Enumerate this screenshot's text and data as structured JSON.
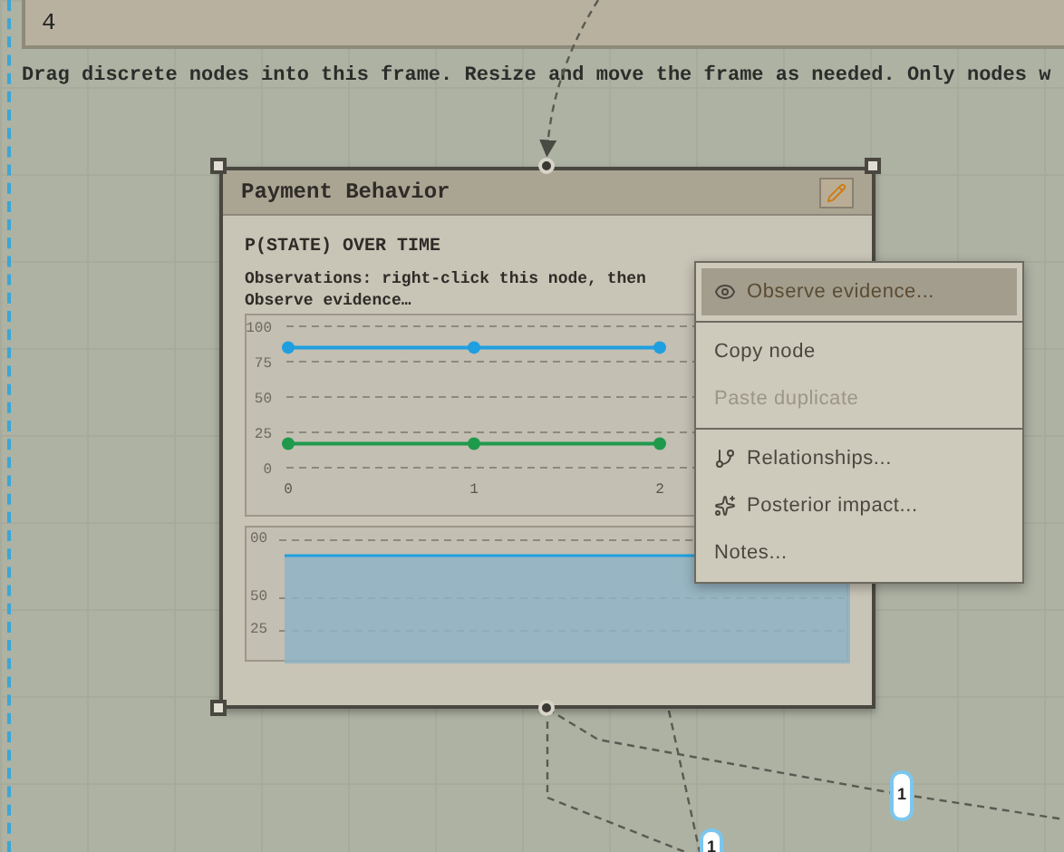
{
  "top_field": {
    "value": "4"
  },
  "hint": "Drag discrete nodes into this frame. Resize and move the frame as needed. Only nodes w",
  "node": {
    "title": "Payment Behavior",
    "section_title": "P(STATE) OVER TIME",
    "note_lines": [
      "Observations: right-click this node, then",
      "Observe evidence…"
    ],
    "chart_data": {
      "type": "line",
      "x": [
        0,
        1,
        2
      ],
      "xlim": [
        0,
        3
      ],
      "xticks": [
        0,
        1,
        2
      ],
      "ylim": [
        0,
        100
      ],
      "yticks": [
        {
          "value": 0,
          "label": "0"
        },
        {
          "value": 25,
          "label": "25"
        },
        {
          "value": 50,
          "label": "50"
        },
        {
          "value": 75,
          "label": "75"
        },
        {
          "value": 100,
          "label": "100"
        }
      ],
      "grid": true,
      "series": [
        {
          "color": "#1f9fe0",
          "marker": "circle",
          "values": [
            85,
            85,
            85
          ]
        },
        {
          "color": "#1f9a4c",
          "marker": "circle",
          "values": [
            17,
            17,
            17
          ]
        }
      ]
    },
    "area_chart": {
      "kind": "area",
      "tick_labels": [
        "00",
        "50",
        "25"
      ]
    }
  },
  "menu": [
    {
      "kind": "item",
      "label": "Observe evidence...",
      "selected": true,
      "disabled": false
    },
    {
      "kind": "separator"
    },
    {
      "kind": "item",
      "label": "Copy node",
      "selected": false,
      "disabled": false
    },
    {
      "kind": "item",
      "label": "Paste duplicate",
      "selected": false,
      "disabled": true
    },
    {
      "kind": "separator"
    },
    {
      "kind": "item",
      "label": "Relationships...",
      "selected": false,
      "disabled": false
    },
    {
      "kind": "item",
      "label": "Posterior impact...",
      "selected": false,
      "disabled": false
    },
    {
      "kind": "item",
      "label": "Notes...",
      "selected": false,
      "disabled": false
    }
  ],
  "badges": [
    "1",
    "1"
  ]
}
